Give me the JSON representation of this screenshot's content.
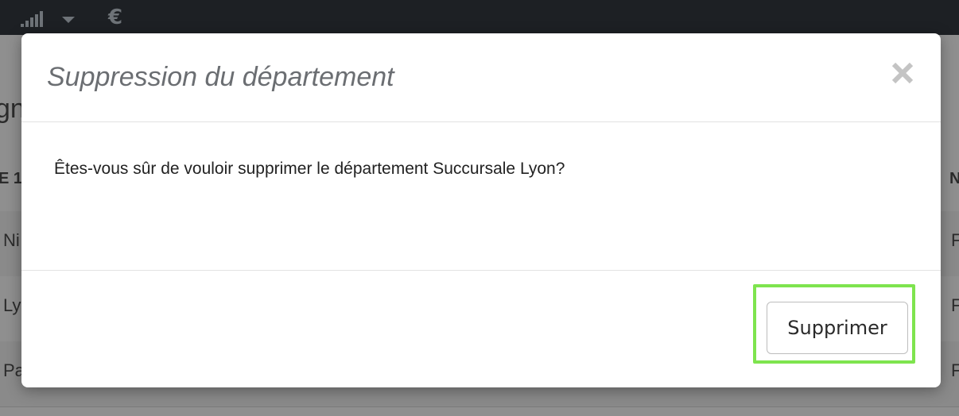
{
  "topbar": {
    "icons": [
      "signal-bars-icon",
      "caret-down-icon"
    ],
    "currency_symbol": "€"
  },
  "background_page": {
    "heading_fragment": "gn",
    "table_header_left_fragment": "E 1",
    "table_header_right_fragment": "N",
    "rows": [
      {
        "left_fragment": "Ni",
        "right_fragment": "F"
      },
      {
        "left_fragment": "Ly",
        "right_fragment": "F"
      },
      {
        "left_fragment": "Pa",
        "right_fragment": "F"
      }
    ]
  },
  "modal": {
    "title": "Suppression du département",
    "close_symbol": "×",
    "message": "Êtes-vous sûr de vouloir supprimer le département Succursale Lyon?",
    "confirm_label": "Supprimer",
    "highlight_color": "#7ee44e"
  }
}
